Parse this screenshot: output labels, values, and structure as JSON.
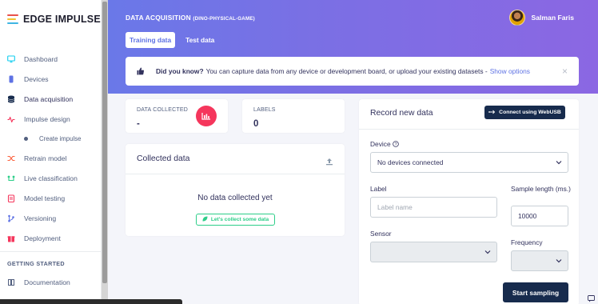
{
  "brand": {
    "name": "EDGE IMPULSE",
    "colors": [
      "#e9524a",
      "#f1c232",
      "#3fb6e3"
    ]
  },
  "sidebar": {
    "items": [
      {
        "label": "Dashboard",
        "icon": "monitor-icon",
        "color": "#11cdef"
      },
      {
        "label": "Devices",
        "icon": "devices-icon",
        "color": "#5e72e4"
      },
      {
        "label": "Data acquisition",
        "icon": "database-icon",
        "color": "#172b4d"
      },
      {
        "label": "Impulse design",
        "icon": "pulse-icon",
        "color": "#f5365c"
      },
      {
        "label": "Create impulse",
        "icon": "dot-icon",
        "color": "#525f7f"
      },
      {
        "label": "Retrain model",
        "icon": "shuffle-icon",
        "color": "#fb6340"
      },
      {
        "label": "Live classification",
        "icon": "live-icon",
        "color": "#2dce89"
      },
      {
        "label": "Model testing",
        "icon": "clipboard-icon",
        "color": "#f5365c"
      },
      {
        "label": "Versioning",
        "icon": "branch-icon",
        "color": "#5e72e4"
      },
      {
        "label": "Deployment",
        "icon": "gift-icon",
        "color": "#f5365c"
      }
    ],
    "section_getting_started": "GETTING STARTED",
    "documentation": "Documentation"
  },
  "header": {
    "title": "DATA ACQUISITION",
    "project": "(DINO-PHYSICAL-GAME)",
    "tabs": [
      "Training data",
      "Test data"
    ],
    "user": "Salman Faris",
    "gradient": [
      "#6a78e8",
      "#8b67e3"
    ]
  },
  "notice": {
    "bold": "Did you know?",
    "text": "You can capture data from any device or development board, or upload your existing datasets -",
    "link": "Show options",
    "close": "×"
  },
  "stats": {
    "collected_label": "DATA COLLECTED",
    "collected_value": "-",
    "labels_label": "LABELS",
    "labels_value": "0"
  },
  "collected": {
    "title": "Collected data",
    "empty": "No data collected yet",
    "collect_button": "Let's collect some data"
  },
  "record": {
    "title": "Record new data",
    "usb_button": "Connect using WebUSB",
    "device_label": "Device",
    "device_value": "No devices connected",
    "label_label": "Label",
    "label_placeholder": "Label name",
    "sample_length_label": "Sample length (ms.)",
    "sample_length_value": "10000",
    "sensor_label": "Sensor",
    "frequency_label": "Frequency",
    "start_button": "Start sampling"
  }
}
